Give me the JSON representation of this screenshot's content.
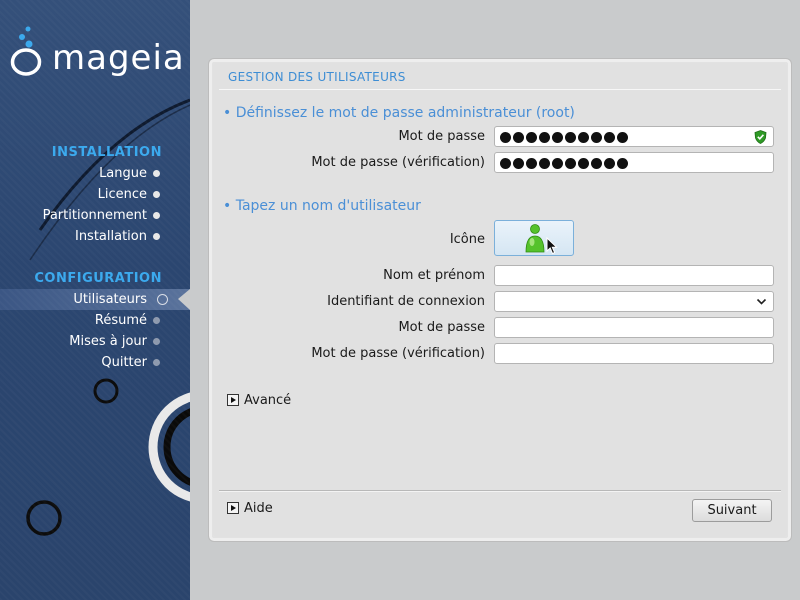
{
  "brand": {
    "logo_text": "mageia"
  },
  "sidebar": {
    "installation_title": "INSTALLATION",
    "installation_items": [
      {
        "label": "Langue",
        "state": "done"
      },
      {
        "label": "Licence",
        "state": "done"
      },
      {
        "label": "Partitionnement",
        "state": "done"
      },
      {
        "label": "Installation",
        "state": "done"
      }
    ],
    "configuration_title": "CONFIGURATION",
    "configuration_items": [
      {
        "label": "Utilisateurs",
        "state": "active"
      },
      {
        "label": "Résumé",
        "state": "pending"
      },
      {
        "label": "Mises à jour",
        "state": "pending"
      },
      {
        "label": "Quitter",
        "state": "pending"
      }
    ]
  },
  "panel": {
    "title": "GESTION DES UTILISATEURS",
    "root_section": {
      "heading": "• Définissez le mot de passe administrateur (root)",
      "password_label": "Mot de passe",
      "password_verify_label": "Mot de passe (vérification)",
      "password_dots": 10,
      "password_verify_dots": 10
    },
    "user_section": {
      "heading": "• Tapez un nom d'utilisateur",
      "icon_label": "Icône",
      "fullname_label": "Nom et prénom",
      "fullname_value": "",
      "login_label": "Identifiant de connexion",
      "login_value": "",
      "password_label": "Mot de passe",
      "password_value": "",
      "password_verify_label": "Mot de passe (vérification)",
      "password_verify_value": ""
    },
    "advanced_label": "Avancé",
    "help_label": "Aide",
    "next_label": "Suivant"
  },
  "colors": {
    "accent": "#3aa9ee",
    "heading_blue": "#4a8fd6",
    "sidebar_bg": "#2b4670",
    "panel_bg": "#e1e1e1",
    "strength_ok": "#3aa12b",
    "avatar_green": "#55c22b"
  },
  "icons": {
    "strength": "shield-check-icon",
    "avatar": "user-avatar-icon",
    "dropdown": "chevron-down-icon",
    "expander": "triangle-right-icon"
  }
}
